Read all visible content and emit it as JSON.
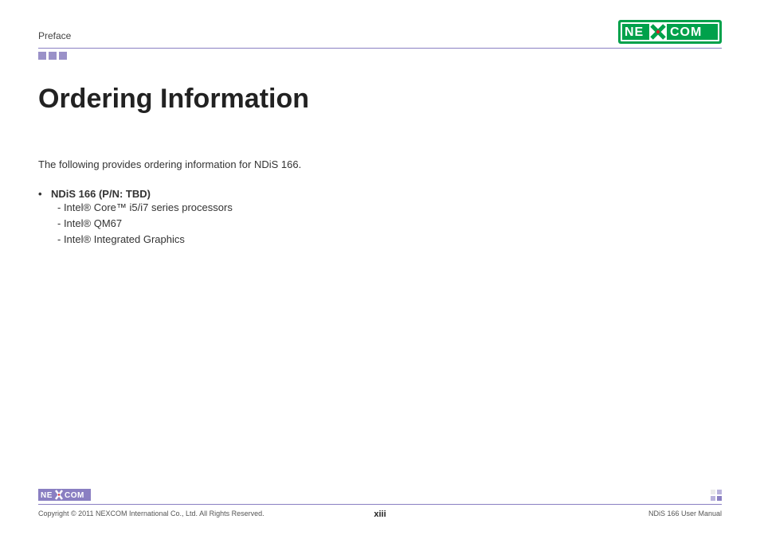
{
  "header": {
    "section": "Preface",
    "logo_text": "NE COM",
    "logo_x": "X"
  },
  "content": {
    "title": "Ordering Information",
    "intro": "The following provides ordering information for NDiS 166.",
    "item_heading": "NDiS 166 (P/N: TBD)",
    "sub1": "- Intel® Core™ i5/i7 series processors",
    "sub2": "- Intel® QM67",
    "sub3": "- Intel® Integrated Graphics"
  },
  "footer": {
    "logo_text": "NE COM",
    "logo_x": "X",
    "copyright": "Copyright © 2011 NEXCOM International Co., Ltd. All Rights Reserved.",
    "page_number": "xiii",
    "doc_name": "NDiS 166 User Manual"
  }
}
